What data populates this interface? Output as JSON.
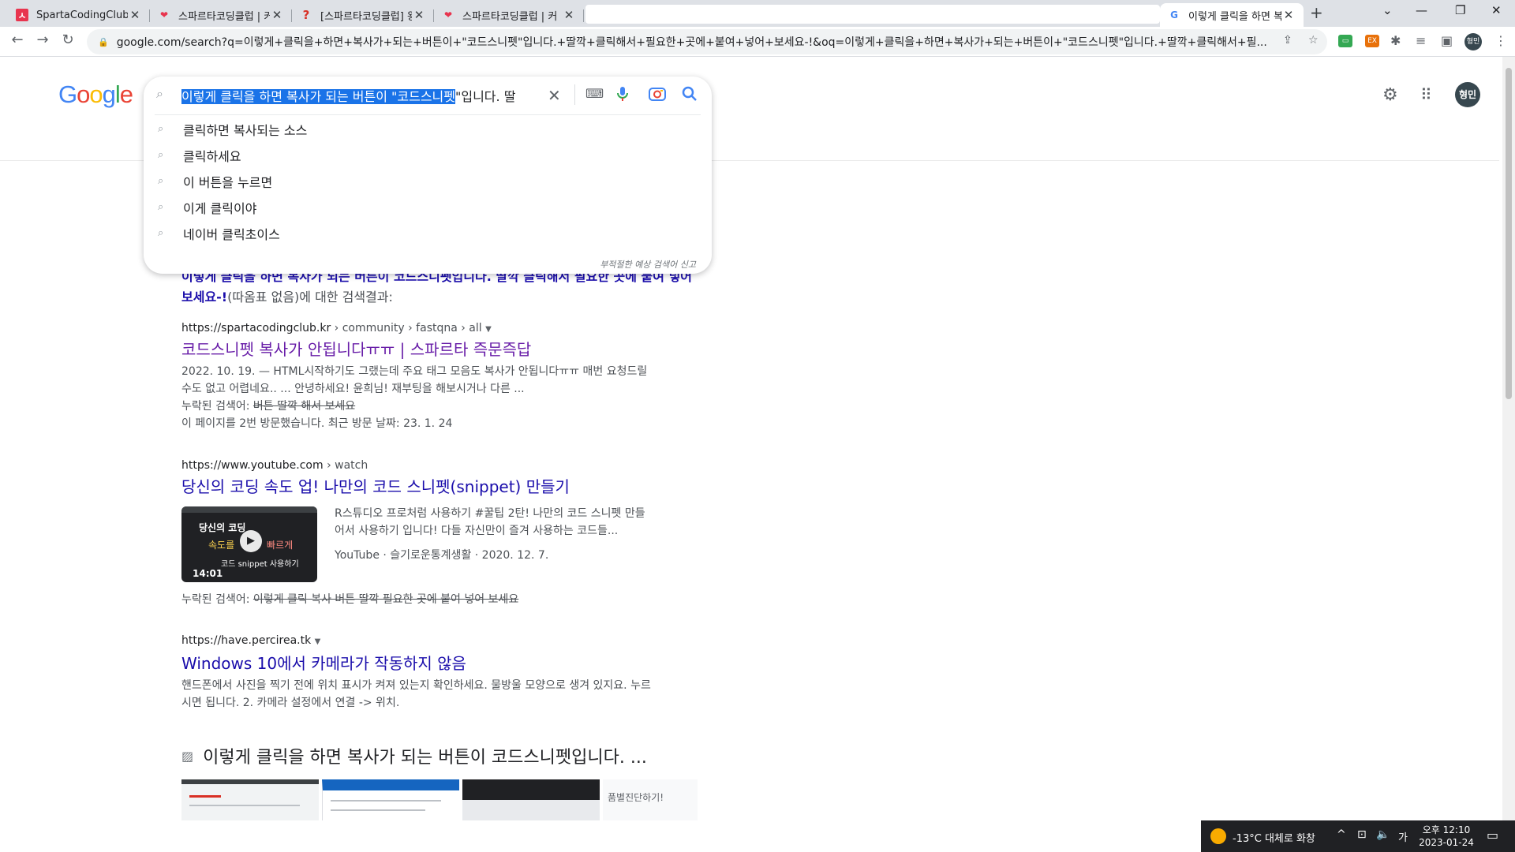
{
  "tabs": [
    {
      "title": "SpartaCodingClub",
      "icon": "sparta-favicon"
    },
    {
      "title": "스파르타코딩클럽 | 커",
      "icon": "heart-favicon"
    },
    {
      "title": "[스파르타코딩클럽] 왕",
      "icon": "question-favicon"
    },
    {
      "title": "스파르타코딩클럽 | 커",
      "icon": "heart-favicon"
    },
    {
      "title": "이렇게 클릭을 하면 복",
      "icon": "google-favicon"
    }
  ],
  "address_bar": {
    "url": "google.com/search?q=이렇게+클릭을+하면+복사가+되는+버튼이+\"코드스니펫\"입니다.+딸깍+클릭해서+필요한+곳에+붙여+넣어+보세요-!&oq=이렇게+클릭을+하면+복사가+되는+버튼이+\"코드스니펫\"입니다.+딸깍+클릭해서+필..."
  },
  "search": {
    "query_selected": "이렇게 클릭을 하면 복사가 되는 버튼이 \"코드스니펫",
    "query_rest": "\"입니다. 딸",
    "suggestions": [
      "클릭하면 복사되는 소스",
      "클릭하세요",
      "이 버튼을 누르면",
      "이게 클릭이야",
      "네이버 클릭초이스"
    ],
    "report_label": "부적절한 예상 검색어 신고"
  },
  "profile": {
    "initials": "형민"
  },
  "results": {
    "correction_bold": "이렇게 클릭을 하면 복사가 되는 버튼이 코드스니펫입니다. 딸깍 클릭해서 필요한 곳에 붙여 넣어 보세요-!",
    "correction_suffix": "(따옴표 없음)에 대한 검색결과:",
    "r1": {
      "site": "https://spartacodingclub.kr",
      "path": " › community › fastqna › all",
      "title": "코드스니펫 복사가 안됩니다ㅠㅠ | 스파르타 즉문즉답",
      "snippet": "2022. 10. 19. — HTML시작하기도 그랬는데 주요 태그 모음도 복사가 안됩니다ㅠㅠ 매번 요청드릴 수도 없고 어렵네요.. ... 안녕하세요! 윤희님! 재부팅을 해보시거나 다른 ...",
      "missing_label": "누락된 검색어: ",
      "missing_terms": "버튼 딸깍 해서 보세요",
      "visit_note": "이 페이지를 2번 방문했습니다. 최근 방문 날짜: 23. 1. 24"
    },
    "r2": {
      "site": "https://www.youtube.com",
      "path": " › watch",
      "title": "당신의 코딩 속도 업! 나만의 코드 스니펫(snippet) 만들기",
      "snippet": "R스튜디오 프로처럼 사용하기 #꿀팁 2탄! 나만의 코드 스니펫 만들어서 사용하기 입니다! 다들 자신만이 즐겨 사용하는 코드들...",
      "meta": "YouTube · 슬기로운통계생활 · 2020. 12. 7.",
      "duration": "14:01",
      "thumb_line1": "당신의 코딩",
      "thumb_line2": "속도를",
      "thumb_line3": "빠르게",
      "thumb_line4": "코드 snippet 사용하기",
      "missing_label": "누락된 검색어: ",
      "missing_terms": "이렇게 클릭 복사 버튼 딸깍 필요한 곳에 붙여 넣어 보세요"
    },
    "r3": {
      "site": "https://have.percirea.tk",
      "title": "Windows 10에서 카메라가 작동하지 않음",
      "snippet": "핸드폰에서 사진을 찍기 전에 위치 표시가 켜져 있는지 확인하세요. 물방울 모양으로 생겨 있지요. 누르시면 됩니다. 2. 카메라 설정에서 연결 -> 위치."
    },
    "images_heading": "이렇게 클릭을 하면 복사가 되는 버튼이 코드스니펫입니다. ...",
    "image_thumb4_text": "품별진단하기!"
  },
  "taskbar": {
    "weather": "-13°C  대체로 화창",
    "ime": "가",
    "time": "오후 12:10",
    "date": "2023-01-24"
  }
}
